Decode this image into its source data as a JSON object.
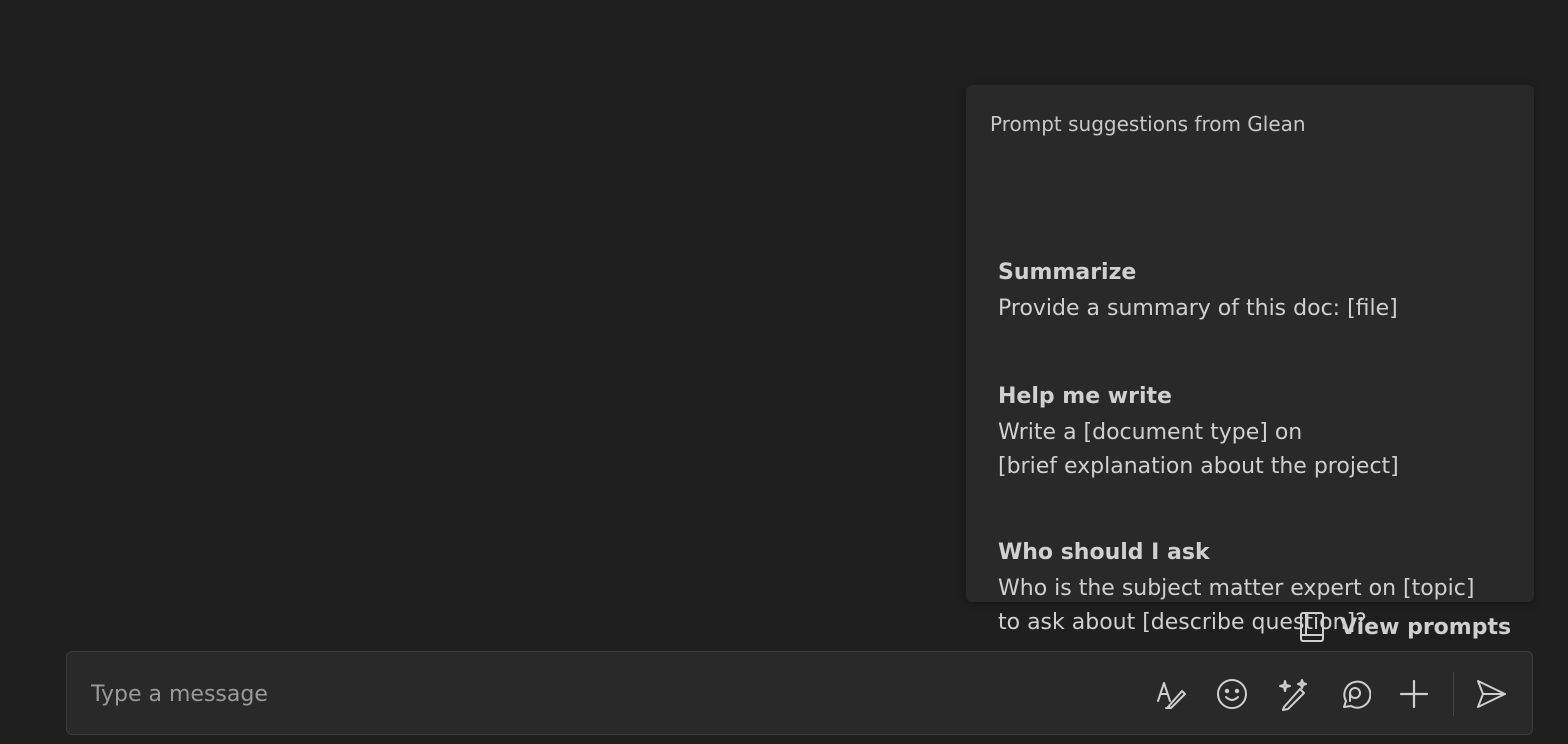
{
  "prompt_panel": {
    "header": "Prompt suggestions from Glean",
    "suggestions": [
      {
        "title": "Summarize",
        "lines": [
          "Provide a summary of this doc: [file]"
        ]
      },
      {
        "title": "Help me write",
        "lines": [
          "Write a [document type] on",
          "[brief explanation about the project]"
        ]
      },
      {
        "title": "Who should I ask",
        "lines": [
          "Who is the subject matter expert on [topic]",
          "to ask about [describe question]?"
        ]
      }
    ]
  },
  "view_prompts": {
    "label": "View prompts",
    "icon": "book-icon"
  },
  "composer": {
    "placeholder": "Type a message",
    "icons": [
      "format-icon",
      "emoji-icon",
      "copilot-sparkle-pen-icon",
      "loop-icon",
      "plus-icon",
      "send-icon"
    ]
  },
  "colors": {
    "background": "#1f1f1f",
    "panel": "#292929",
    "text": "#d0d0d0",
    "muted": "#9a9a9a"
  }
}
